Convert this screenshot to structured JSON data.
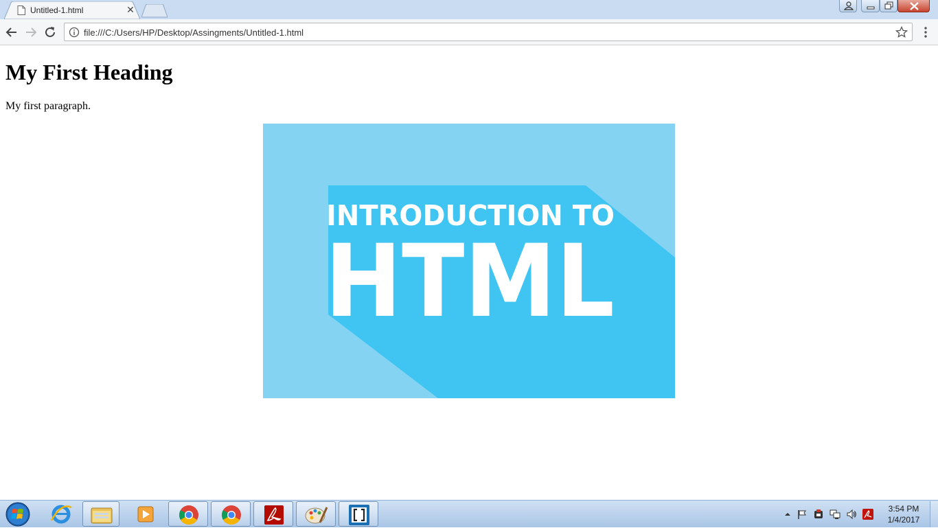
{
  "window": {
    "tab": {
      "title": "Untitled-1.html",
      "close_glyph": "✕",
      "icon": "document-icon"
    }
  },
  "toolbar": {
    "url": "file:///C:/Users/HP/Desktop/Assingments/Untitled-1.html",
    "back_icon": "back-arrow-icon",
    "forward_icon": "forward-arrow-icon",
    "reload_icon": "reload-icon",
    "info_icon": "info-icon",
    "bookmark_icon": "star-icon",
    "menu_icon": "kebab-menu-icon"
  },
  "page": {
    "heading": "My First Heading",
    "paragraph": "My first paragraph.",
    "image": {
      "line1": "INTRODUCTION TO",
      "line2": "HTML",
      "bg_color": "#40c4f2",
      "light_color": "#84d3f2"
    }
  },
  "taskbar": {
    "apps": [
      "start-orb-icon",
      "internet-explorer-icon",
      "file-explorer-icon",
      "media-player-icon",
      "chrome-icon",
      "chrome-icon",
      "acrobat-icon",
      "paint-icon",
      "brackets-icon"
    ],
    "clock": {
      "time": "3:54 PM",
      "date": "1/4/2017"
    }
  }
}
